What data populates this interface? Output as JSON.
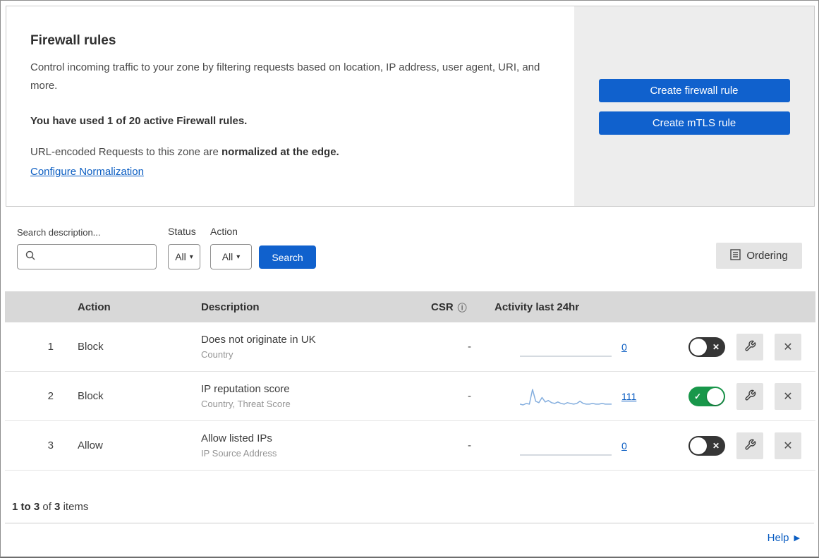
{
  "page": {
    "help_label": "Help"
  },
  "icons": {
    "caret": "▾",
    "info": "ⓘ",
    "close": "✕",
    "toggle_on": "✓",
    "toggle_off": "✕",
    "help_arrow": "▶"
  },
  "colors": {
    "button_blue": "#1061cd",
    "link_blue": "#0a5dc2",
    "toggle_on_green": "#18974a",
    "table_header_gray": "#d8d8d8"
  },
  "header": {
    "title": "Firewall rules",
    "description": "Control incoming traffic to your zone by filtering requests based on location, IP address, user agent, URI, and more.",
    "usage_text": "You have used 1 of 20 active Firewall rules.",
    "normalization_prefix": "URL-encoded Requests to this zone are",
    "normalization_bold": "normalized at the edge.",
    "normalization_link": "Configure Normalization",
    "buttons": {
      "create_firewall": "Create firewall rule",
      "create_mtls": "Create mTLS rule"
    }
  },
  "filters": {
    "search_label": "Search description...",
    "status_label": "Status",
    "status_value": "All",
    "action_label": "Action",
    "action_value": "All",
    "search_button": "Search",
    "ordering_button": "Ordering"
  },
  "table": {
    "headers": {
      "action": "Action",
      "description": "Description",
      "csr": "CSR",
      "activity": "Activity last 24hr"
    },
    "rows": [
      {
        "number": "1",
        "action": "Block",
        "description": "Does not originate in UK",
        "criteria": "Country",
        "csr": "-",
        "activity_count": "0",
        "enabled": false,
        "sparkline": [
          0,
          0
        ]
      },
      {
        "number": "2",
        "action": "Block",
        "description": "IP reputation score",
        "criteria": "Country, Threat Score",
        "csr": "-",
        "activity_count": "111",
        "enabled": true,
        "sparkline": [
          2,
          1,
          3,
          2,
          22,
          6,
          4,
          11,
          5,
          7,
          4,
          3,
          5,
          3,
          2,
          4,
          3,
          2,
          3,
          6,
          3,
          2,
          2,
          3,
          2,
          2,
          3,
          2,
          2,
          2
        ]
      },
      {
        "number": "3",
        "action": "Allow",
        "description": "Allow listed IPs",
        "criteria": "IP Source Address",
        "csr": "-",
        "activity_count": "0",
        "enabled": false,
        "sparkline": [
          0,
          0
        ]
      }
    ],
    "summary": {
      "range": "1 to 3",
      "of": "of",
      "total": "3",
      "items": "items"
    }
  }
}
